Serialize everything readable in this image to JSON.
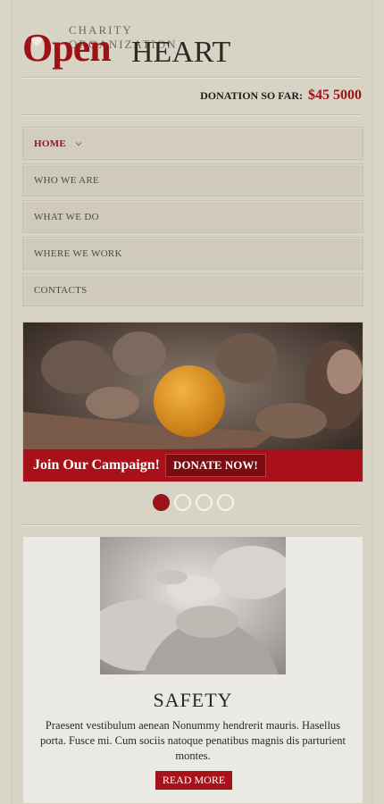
{
  "header": {
    "tagline": "CHARITY ORGANIZATION",
    "logo_open": "Open",
    "logo_heart": "HEART",
    "donation_label": "DONATION SO FAR:",
    "donation_amount": "$45 5000"
  },
  "nav": {
    "items": [
      {
        "label": "HOME"
      },
      {
        "label": "WHO WE ARE"
      },
      {
        "label": "WHAT WE DO"
      },
      {
        "label": "WHERE WE WORK"
      },
      {
        "label": "CONTACTS"
      }
    ]
  },
  "slider": {
    "caption": "Join Our Campaign!",
    "button": "DONATE NOW!",
    "slides_total": 4,
    "active_slide": 1
  },
  "card": {
    "title": "SAFETY",
    "text": "Praesent vestibulum aenean Nonummy hendrerit mauris. Hasellus porta. Fusce mi. Cum sociis natoque penatibus magnis dis parturient montes.",
    "button": "READ MORE"
  },
  "colors": {
    "brand_red": "#9c1217",
    "background": "#d7d3c5"
  }
}
